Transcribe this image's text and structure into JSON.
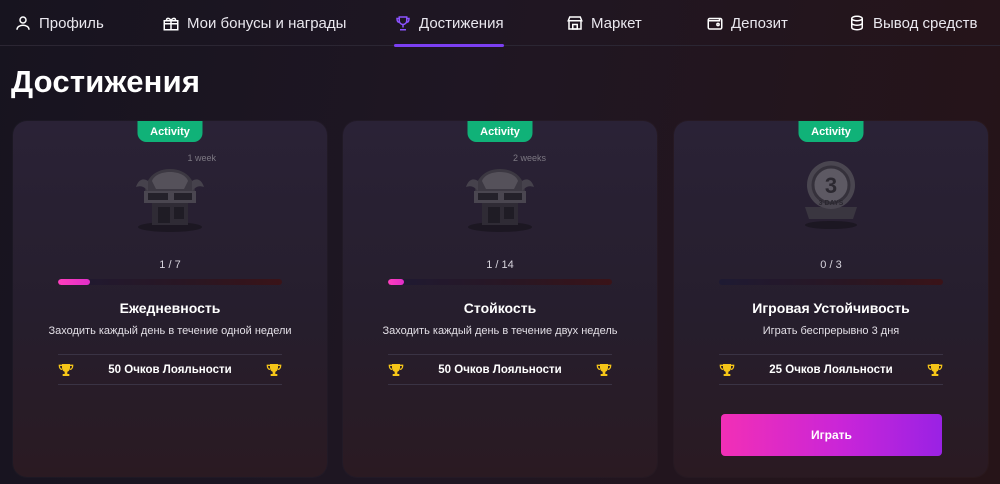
{
  "nav": {
    "items": [
      {
        "label": "Профиль",
        "icon": "user-icon"
      },
      {
        "label": "Мои бонусы и награды",
        "icon": "gift-icon"
      },
      {
        "label": "Достижения",
        "icon": "trophy-icon"
      },
      {
        "label": "Маркет",
        "icon": "store-icon"
      },
      {
        "label": "Депозит",
        "icon": "wallet-icon"
      },
      {
        "label": "Вывод средств",
        "icon": "coins-icon"
      }
    ],
    "active_index": 2
  },
  "page_title": "Достижения",
  "colors": {
    "accent": "#7b3ff2",
    "badge_green": "#10b278",
    "progress_pink": "#ff3fbd",
    "trophy_gold": "#f5c518",
    "button_start": "#f22fb6",
    "button_end": "#9a22e4"
  },
  "cards": [
    {
      "badge": "Activity",
      "art_icon": "gaming-setup-image",
      "art_label": "1 week",
      "progress_text": "1 / 7",
      "progress": 0.143,
      "title": "Ежедневность",
      "description": "Заходить каждый день в течение одной недели",
      "reward": "50 Очков Лояльности"
    },
    {
      "badge": "Activity",
      "art_icon": "gaming-setup-image",
      "art_label": "2 weeks",
      "progress_text": "1 / 14",
      "progress": 0.071,
      "title": "Стойкость",
      "description": "Заходить каждый день в течение двух недель",
      "reward": "50 Очков Лояльности"
    },
    {
      "badge": "Activity",
      "art_icon": "days-medal-image",
      "art_label": "3 DAYS",
      "progress_text": "0 / 3",
      "progress": 0,
      "title": "Игровая Устойчивость",
      "description": "Играть беспрерывно 3 дня",
      "reward": "25 Очков Лояльности",
      "button": "Играть"
    }
  ]
}
